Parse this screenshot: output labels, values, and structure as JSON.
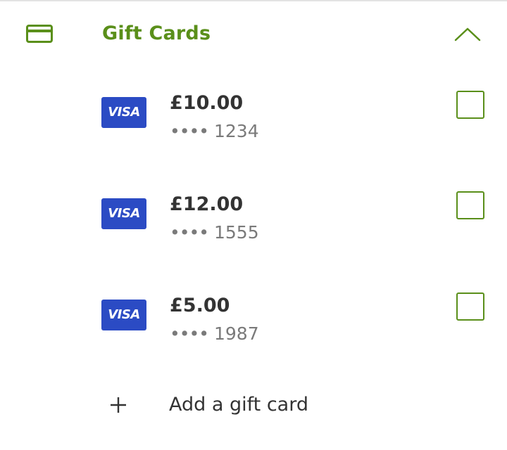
{
  "section": {
    "icon": "credit-card-icon",
    "title": "Gift Cards",
    "collapse_icon": "chevron-up-icon",
    "accent_color": "#5a8f1a"
  },
  "gift_cards": [
    {
      "brand": "VISA",
      "amount": "£10.00",
      "masked": "••••",
      "last4": "1234",
      "checked": false
    },
    {
      "brand": "VISA",
      "amount": "£12.00",
      "masked": "••••",
      "last4": "1555",
      "checked": false
    },
    {
      "brand": "VISA",
      "amount": "£5.00",
      "masked": "••••",
      "last4": "1987",
      "checked": false
    }
  ],
  "add_card": {
    "icon": "plus-icon",
    "label": "Add a gift card"
  }
}
